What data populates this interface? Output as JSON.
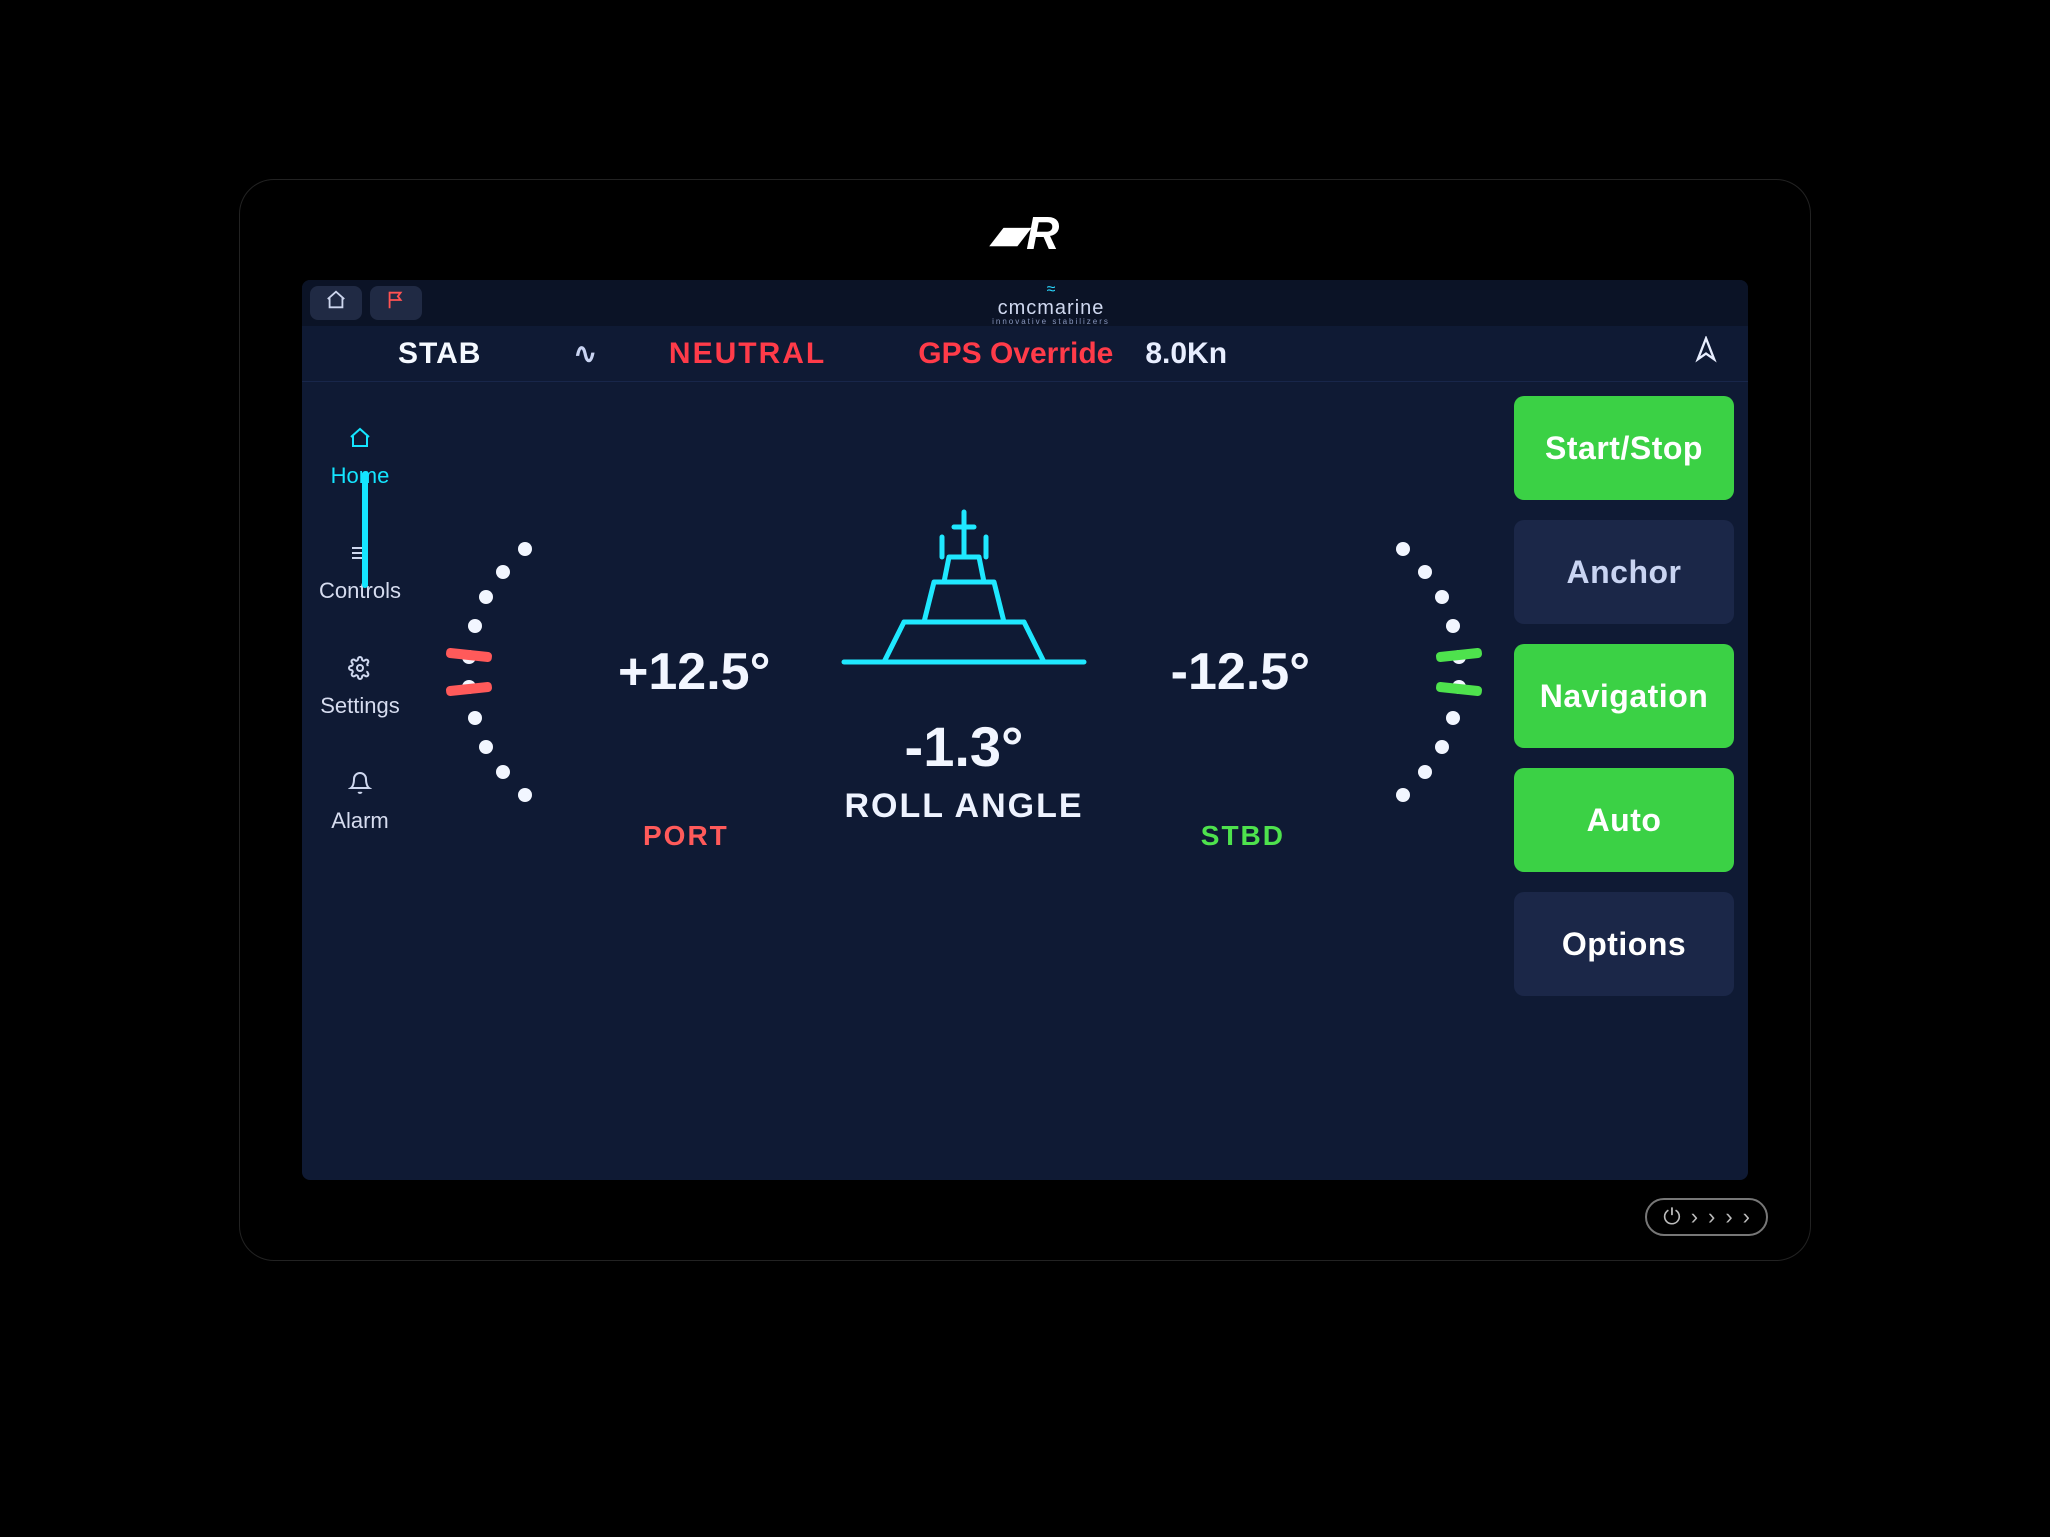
{
  "bezel": {
    "logo": "▰R"
  },
  "brand": {
    "name": "cmcmarine",
    "sub": "innovative stabilizers"
  },
  "status": {
    "mode": "STAB",
    "neutral": "NEUTRAL",
    "gps_label": "GPS Override",
    "speed": "8.0Kn"
  },
  "sidebar": {
    "items": [
      {
        "icon": "home",
        "label": "Home"
      },
      {
        "icon": "controls",
        "label": "Controls"
      },
      {
        "icon": "settings",
        "label": "Settings"
      },
      {
        "icon": "alarm",
        "label": "Alarm"
      }
    ],
    "active_index": 0
  },
  "gauge": {
    "port_reading": "+12.5°",
    "stbd_reading": "-12.5°",
    "port_label": "PORT",
    "stbd_label": "STBD",
    "roll_value": "-1.3°",
    "roll_label": "ROLL ANGLE"
  },
  "actions": [
    {
      "label": "Start/Stop",
      "style": "green"
    },
    {
      "label": "Anchor",
      "style": "dark"
    },
    {
      "label": "Navigation",
      "style": "green"
    },
    {
      "label": "Auto",
      "style": "green"
    },
    {
      "label": "Options",
      "style": "dark strong"
    }
  ],
  "colors": {
    "accent_cyan": "#14e5ff",
    "accent_green": "#3bd145",
    "accent_red": "#ff3b49",
    "bg": "#0f1a34"
  }
}
